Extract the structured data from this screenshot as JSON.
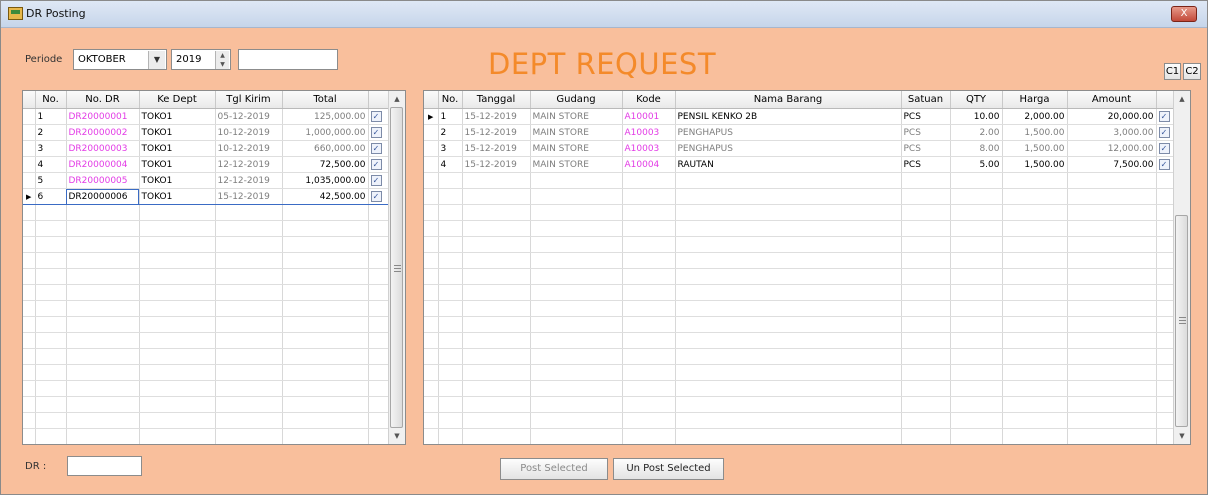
{
  "window": {
    "title": "DR Posting",
    "close_label": "X"
  },
  "filter": {
    "periode_label": "Periode",
    "month": "OKTOBER",
    "year": "2019",
    "extra": ""
  },
  "page_title": "DEPT REQUEST",
  "buttons": {
    "c1": "C1",
    "c2": "C2",
    "post_selected": "Post Selected",
    "unpost_selected": "Un Post Selected"
  },
  "footer": {
    "dr_label": "DR :",
    "dr_value": ""
  },
  "left_grid": {
    "columns": [
      "No.",
      "No. DR",
      "Ke Dept",
      "Tgl Kirim",
      "Total",
      ""
    ],
    "rows": [
      {
        "no": "1",
        "no_dr": "DR20000001",
        "ke_dept": "TOKO1",
        "tgl": "05-12-2019",
        "total": "125,000.00",
        "checked": true
      },
      {
        "no": "2",
        "no_dr": "DR20000002",
        "ke_dept": "TOKO1",
        "tgl": "10-12-2019",
        "total": "1,000,000.00",
        "checked": true
      },
      {
        "no": "3",
        "no_dr": "DR20000003",
        "ke_dept": "TOKO1",
        "tgl": "10-12-2019",
        "total": "660,000.00",
        "checked": true
      },
      {
        "no": "4",
        "no_dr": "DR20000004",
        "ke_dept": "TOKO1",
        "tgl": "12-12-2019",
        "total": "72,500.00",
        "checked": true
      },
      {
        "no": "5",
        "no_dr": "DR20000005",
        "ke_dept": "TOKO1",
        "tgl": "12-12-2019",
        "total": "1,035,000.00",
        "checked": true
      },
      {
        "no": "6",
        "no_dr": "DR20000006",
        "ke_dept": "TOKO1",
        "tgl": "15-12-2019",
        "total": "42,500.00",
        "checked": true
      }
    ]
  },
  "right_grid": {
    "columns": [
      "No.",
      "Tanggal",
      "Gudang",
      "Kode",
      "Nama Barang",
      "Satuan",
      "QTY",
      "Harga",
      "Amount",
      ""
    ],
    "rows": [
      {
        "no": "1",
        "tanggal": "15-12-2019",
        "gudang": "MAIN STORE",
        "kode": "A10001",
        "nama": "PENSIL KENKO 2B",
        "satuan": "PCS",
        "qty": "10.00",
        "harga": "2,000.00",
        "amount": "20,000.00",
        "checked": true
      },
      {
        "no": "2",
        "tanggal": "15-12-2019",
        "gudang": "MAIN STORE",
        "kode": "A10003",
        "nama": "PENGHAPUS",
        "satuan": "PCS",
        "qty": "2.00",
        "harga": "1,500.00",
        "amount": "3,000.00",
        "checked": true
      },
      {
        "no": "3",
        "tanggal": "15-12-2019",
        "gudang": "MAIN STORE",
        "kode": "A10003",
        "nama": "PENGHAPUS",
        "satuan": "PCS",
        "qty": "8.00",
        "harga": "1,500.00",
        "amount": "12,000.00",
        "checked": true
      },
      {
        "no": "4",
        "tanggal": "15-12-2019",
        "gudang": "MAIN STORE",
        "kode": "A10004",
        "nama": "RAUTAN",
        "satuan": "PCS",
        "qty": "5.00",
        "harga": "1,500.00",
        "amount": "7,500.00",
        "checked": true
      }
    ]
  }
}
